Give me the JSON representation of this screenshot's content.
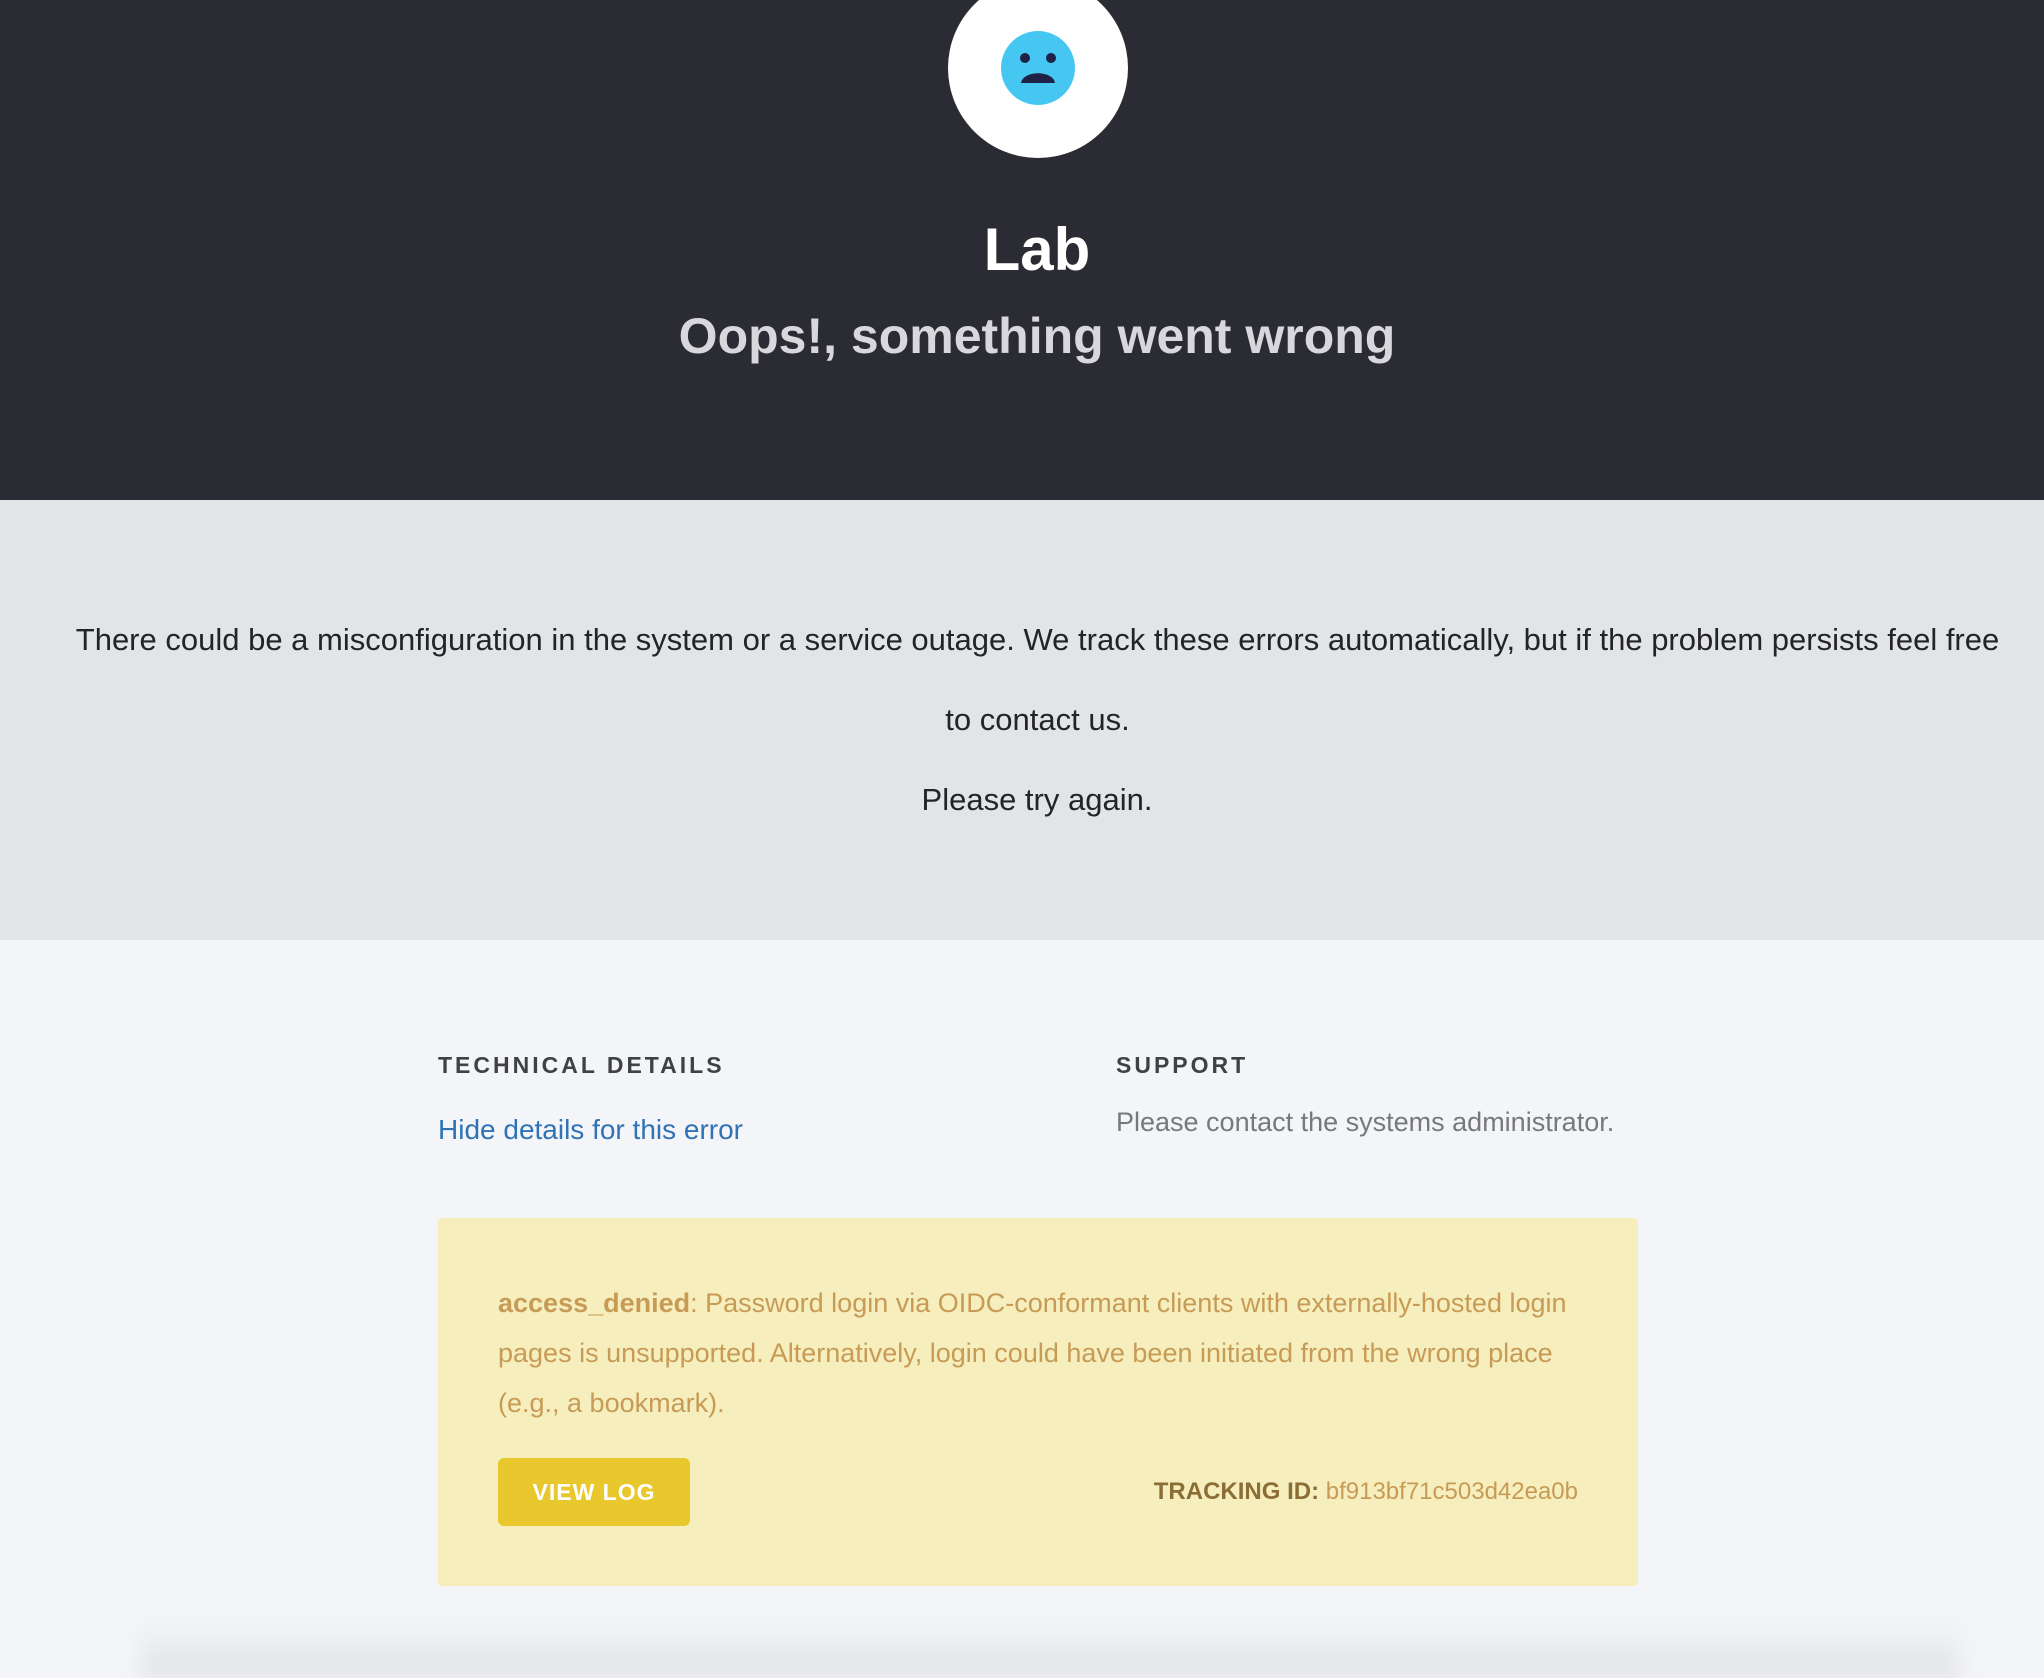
{
  "header": {
    "logo_icon": "sad-face-icon",
    "title": "Lab",
    "subtitle": "Oops!, something went wrong"
  },
  "message": {
    "body": "There could be a misconfiguration in the system or a service outage. We track these errors automatically, but if the problem persists feel free to contact us.",
    "retry": "Please try again."
  },
  "technical_details": {
    "heading": "TECHNICAL DETAILS",
    "toggle_link": "Hide details for this error"
  },
  "support": {
    "heading": "SUPPORT",
    "text": "Please contact the systems administrator."
  },
  "error": {
    "code": "access_denied",
    "description": ": Password login via OIDC-conformant clients with externally-hosted login pages is unsupported. Alternatively, login could have been initiated from the wrong place (e.g., a bookmark).",
    "view_log_label": "VIEW LOG",
    "tracking_label": "TRACKING ID:",
    "tracking_id": "bf913bf71c503d42ea0b"
  },
  "colors": {
    "header_bg": "#2a2b33",
    "accent_link": "#2f73b5",
    "icon_blue": "#45c7f2",
    "warning_bg": "#f6eebd",
    "button_yellow": "#e8c82c"
  }
}
